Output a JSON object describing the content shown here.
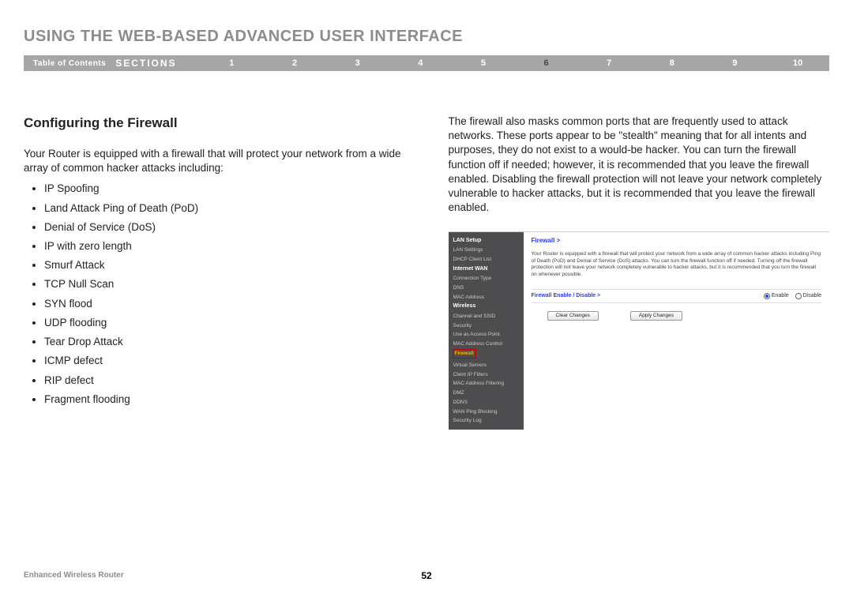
{
  "header": {
    "title": "USING THE WEB-BASED ADVANCED USER INTERFACE",
    "toc": "Table of Contents",
    "sections": "SECTIONS",
    "nums": [
      "1",
      "2",
      "3",
      "4",
      "5",
      "6",
      "7",
      "8",
      "9",
      "10"
    ],
    "active_index": 5
  },
  "left": {
    "title": "Configuring the Firewall",
    "intro": "Your Router is equipped with a firewall that will protect your network from a wide array of common hacker attacks including:",
    "bullets": [
      "IP Spoofing",
      "Land Attack Ping of Death (PoD)",
      "Denial of Service (DoS)",
      "IP with zero length",
      "Smurf Attack",
      "TCP Null Scan",
      "SYN flood",
      "UDP flooding",
      "Tear Drop Attack",
      "ICMP defect",
      "RIP defect",
      "Fragment flooding"
    ]
  },
  "right": {
    "para": "The firewall also masks common ports that are frequently used to attack networks. These ports appear to be \"stealth\" meaning that for all intents and purposes, they do not exist to a would-be hacker. You can turn the firewall function off if needed; however, it is recommended that you leave the firewall enabled. Disabling the firewall protection will not leave your network completely vulnerable to hacker attacks, but it is recommended that you leave the firewall enabled."
  },
  "ui": {
    "side": [
      {
        "label": "LAN Setup",
        "head": true
      },
      {
        "label": "LAN Settings"
      },
      {
        "label": "DHCP Client List"
      },
      {
        "label": "Internet WAN",
        "head": true
      },
      {
        "label": "Connection Type"
      },
      {
        "label": "DNS"
      },
      {
        "label": "MAC Address"
      },
      {
        "label": "Wireless",
        "head": true
      },
      {
        "label": "Channel and SSID"
      },
      {
        "label": "Security"
      },
      {
        "label": "Use as Access Point"
      },
      {
        "label": "MAC Address Control"
      },
      {
        "label": "Firewall",
        "highlight": true
      },
      {
        "label": "Virtual Servers"
      },
      {
        "label": "Client IP Filters"
      },
      {
        "label": "MAC Address Filtering"
      },
      {
        "label": "DMZ"
      },
      {
        "label": "DDNS"
      },
      {
        "label": "WAN Ping Blocking"
      },
      {
        "label": "Security Log"
      }
    ],
    "main": {
      "title": "Firewall >",
      "desc": "Your Router is equipped with a firewall that will protect your network from a wide array of common hacker attacks including Ping of Death (PoD) and Denial of Service (DoS) attacks. You can turn the firewall function off if needed. Turning off the firewall protection will not leave your network completely vulnerable to hacker attacks, but it is recommended that you turn the firewall on whenever possible.",
      "ctrl_label": "Firewall Enable / Disable >",
      "opt_enable": "Enable",
      "opt_disable": "Disable",
      "btn_clear": "Clear Changes",
      "btn_apply": "Apply Changes"
    }
  },
  "footer": {
    "product": "Enhanced Wireless Router",
    "page": "52"
  }
}
